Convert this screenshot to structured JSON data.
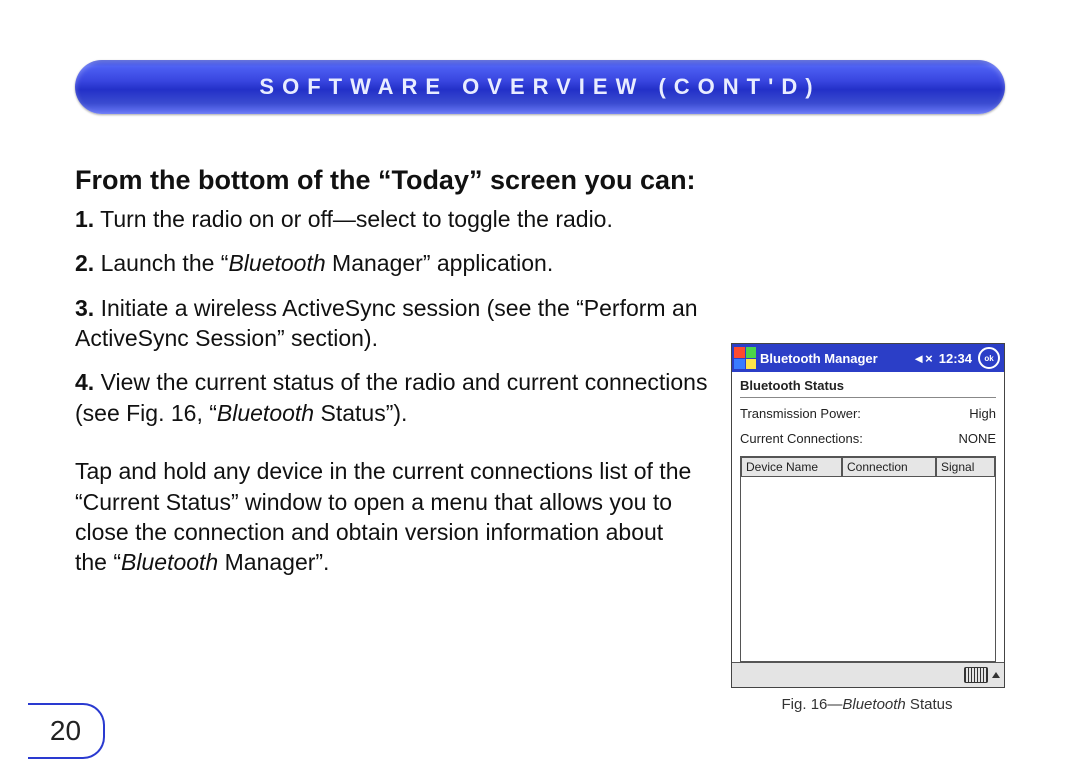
{
  "header": {
    "title": "SOFTWARE OVERVIEW (CONT'D)"
  },
  "section_heading": "From the bottom of the “Today” screen you can:",
  "items": [
    {
      "num": "1.",
      "text_a": " Turn the radio on or off—select to toggle the radio."
    },
    {
      "num": "2.",
      "text_a": " Launch the “",
      "ital": "Bluetooth",
      "text_b": " Manager” application."
    },
    {
      "num": "3.",
      "text_a": " Initiate a wireless ActiveSync session (see the “Perform an ActiveSync Session” section)."
    },
    {
      "num": "4.",
      "text_a": " View the current status of the radio and current connections (see Fig. 16, “",
      "ital": "Bluetooth",
      "text_b": " Status”)."
    }
  ],
  "paragraph": {
    "a": "Tap and hold any device in the current connections list of the “Current Status” window to open a menu that allows you to close the connection and obtain version information about the “",
    "ital": "Bluetooth",
    "b": " Manager”."
  },
  "page_number": "20",
  "figure": {
    "titlebar": {
      "app": "Bluetooth Manager",
      "speaker": "◄×",
      "time": "12:34"
    },
    "status_title": "Bluetooth Status",
    "rows": {
      "power_label": "Transmission Power:",
      "power_value": "High",
      "conn_label": "Current Connections:",
      "conn_value": "NONE"
    },
    "table_headers": {
      "device": "Device Name",
      "connection": "Connection",
      "signal": "Signal"
    },
    "caption_pre": "Fig. 16—",
    "caption_ital": "Bluetooth",
    "caption_post": " Status"
  }
}
